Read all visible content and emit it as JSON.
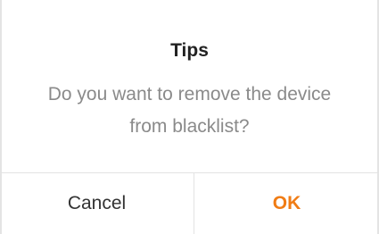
{
  "dialog": {
    "title": "Tips",
    "message": "Do you want to remove the device from blacklist?",
    "cancel_label": "Cancel",
    "ok_label": "OK"
  },
  "colors": {
    "accent": "#f07c15",
    "title_text": "#222222",
    "message_text": "#8a8a8a",
    "divider": "#e3e3e3"
  }
}
